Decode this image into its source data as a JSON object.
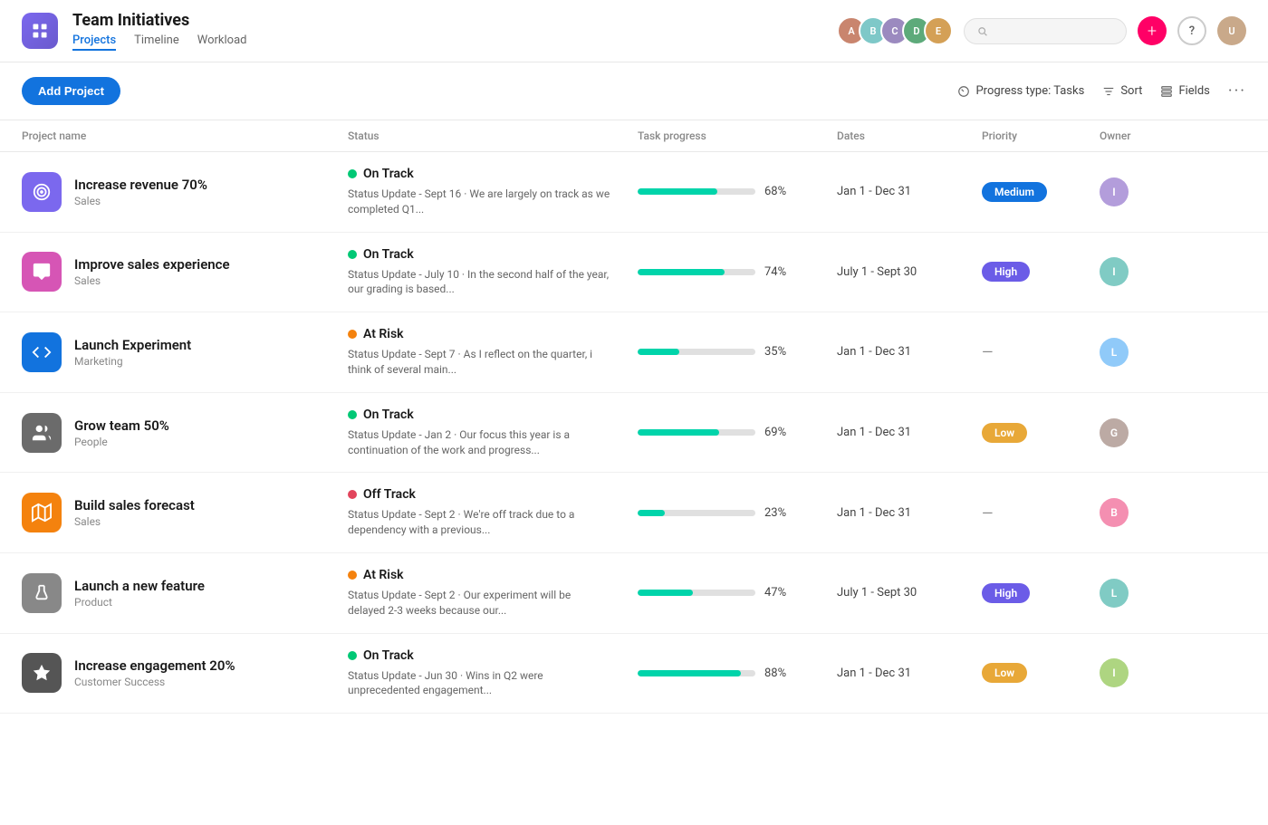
{
  "app": {
    "title": "Team Initiatives",
    "icon": "chart-icon"
  },
  "nav": {
    "tabs": [
      {
        "label": "Projects",
        "active": true
      },
      {
        "label": "Timeline",
        "active": false
      },
      {
        "label": "Workload",
        "active": false
      }
    ]
  },
  "header": {
    "add_btn": "+",
    "help_btn": "?",
    "search_placeholder": ""
  },
  "toolbar": {
    "add_project_label": "Add Project",
    "progress_type_label": "Progress type: Tasks",
    "sort_label": "Sort",
    "fields_label": "Fields"
  },
  "table": {
    "columns": [
      "Project name",
      "Status",
      "Task progress",
      "Dates",
      "Priority",
      "Owner"
    ]
  },
  "projects": [
    {
      "name": "Increase revenue 70%",
      "team": "Sales",
      "icon_color": "#7b68ee",
      "icon_type": "target",
      "status": "On Track",
      "status_type": "green",
      "status_desc": "Status Update - Sept 16 · We are largely on track as we completed Q1...",
      "progress": 68,
      "dates": "Jan 1 - Dec 31",
      "priority": "Medium",
      "priority_type": "medium",
      "owner_color": "#b39ddb"
    },
    {
      "name": "Improve sales experience",
      "team": "Sales",
      "icon_color": "#d655b5",
      "icon_type": "chat",
      "status": "On Track",
      "status_type": "green",
      "status_desc": "Status Update - July 10 · In the second half of the year, our grading is based...",
      "progress": 74,
      "dates": "July 1 - Sept 30",
      "priority": "High",
      "priority_type": "high",
      "owner_color": "#80cbc4"
    },
    {
      "name": "Launch Experiment",
      "team": "Marketing",
      "icon_color": "#1273de",
      "icon_type": "code",
      "status": "At Risk",
      "status_type": "orange",
      "status_desc": "Status Update - Sept 7 · As I reflect on the quarter, i think of several main...",
      "progress": 35,
      "dates": "Jan 1 - Dec 31",
      "priority": "",
      "priority_type": "none",
      "owner_color": "#90caf9"
    },
    {
      "name": "Grow team 50%",
      "team": "People",
      "icon_color": "#6b6b6b",
      "icon_type": "people",
      "status": "On Track",
      "status_type": "green",
      "status_desc": "Status Update - Jan 2 · Our focus this year is a continuation of the work and progress...",
      "progress": 69,
      "dates": "Jan 1 - Dec 31",
      "priority": "Low",
      "priority_type": "low",
      "owner_color": "#bcaaa4"
    },
    {
      "name": "Build sales forecast",
      "team": "Sales",
      "icon_color": "#f4820e",
      "icon_type": "map",
      "status": "Off Track",
      "status_type": "red",
      "status_desc": "Status Update - Sept 2 · We're off track due to a dependency with a previous...",
      "progress": 23,
      "dates": "Jan 1 - Dec 31",
      "priority": "",
      "priority_type": "none",
      "owner_color": "#f48fb1"
    },
    {
      "name": "Launch a new feature",
      "team": "Product",
      "icon_color": "#888",
      "icon_type": "flask",
      "status": "At Risk",
      "status_type": "orange",
      "status_desc": "Status Update - Sept 2 · Our experiment will be delayed 2-3 weeks because our...",
      "progress": 47,
      "dates": "July 1 - Sept 30",
      "priority": "High",
      "priority_type": "high",
      "owner_color": "#80cbc4"
    },
    {
      "name": "Increase engagement 20%",
      "team": "Customer Success",
      "icon_color": "#555",
      "icon_type": "star",
      "status": "On Track",
      "status_type": "green",
      "status_desc": "Status Update - Jun 30 · Wins in Q2 were unprecedented engagement...",
      "progress": 88,
      "dates": "Jan 1 - Dec 31",
      "priority": "Low",
      "priority_type": "low",
      "owner_color": "#aed581"
    }
  ]
}
